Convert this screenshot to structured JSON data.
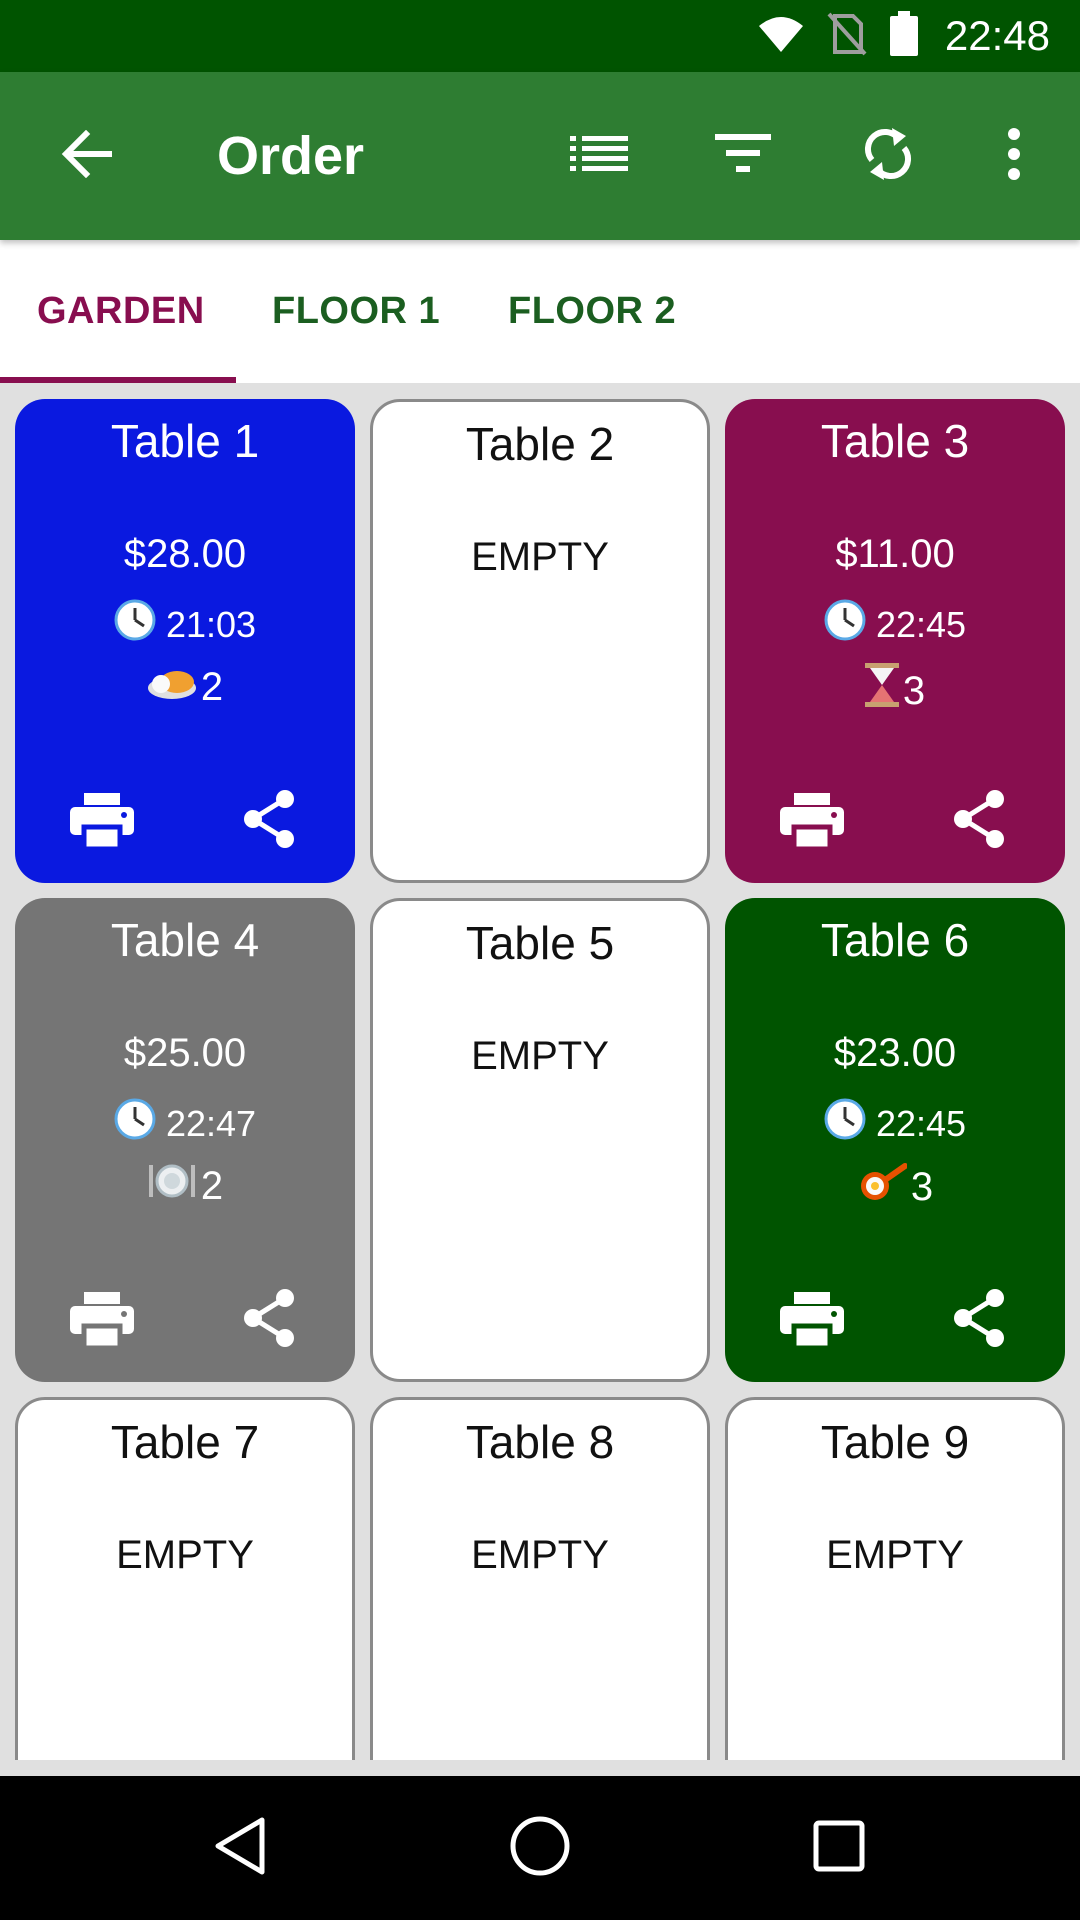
{
  "status_bar": {
    "time": "22:48"
  },
  "app_bar": {
    "title": "Order",
    "bg_color": "#2e7d32"
  },
  "tabs": [
    {
      "label": "GARDEN",
      "active": true
    },
    {
      "label": "FLOOR 1",
      "active": false
    },
    {
      "label": "FLOOR 2",
      "active": false
    }
  ],
  "tables": [
    {
      "name": "Table 1",
      "status": "filled",
      "amount": "$28.00",
      "time": "21:03",
      "count": "2",
      "count_icon": "plate-food-icon",
      "color": "#0a19e0"
    },
    {
      "name": "Table 2",
      "status": "EMPTY"
    },
    {
      "name": "Table 3",
      "status": "filled",
      "amount": "$11.00",
      "time": "22:45",
      "count": "3",
      "count_icon": "hourglass-icon",
      "color": "#880e4f"
    },
    {
      "name": "Table 4",
      "status": "filled",
      "amount": "$25.00",
      "time": "22:47",
      "count": "2",
      "count_icon": "plate-cutlery-icon",
      "color": "#757575"
    },
    {
      "name": "Table 5",
      "status": "EMPTY"
    },
    {
      "name": "Table 6",
      "status": "filled",
      "amount": "$23.00",
      "time": "22:45",
      "count": "3",
      "count_icon": "frying-pan-icon",
      "color": "#005400"
    },
    {
      "name": "Table 7",
      "status": "EMPTY"
    },
    {
      "name": "Table 8",
      "status": "EMPTY"
    },
    {
      "name": "Table 9",
      "status": "EMPTY"
    }
  ]
}
